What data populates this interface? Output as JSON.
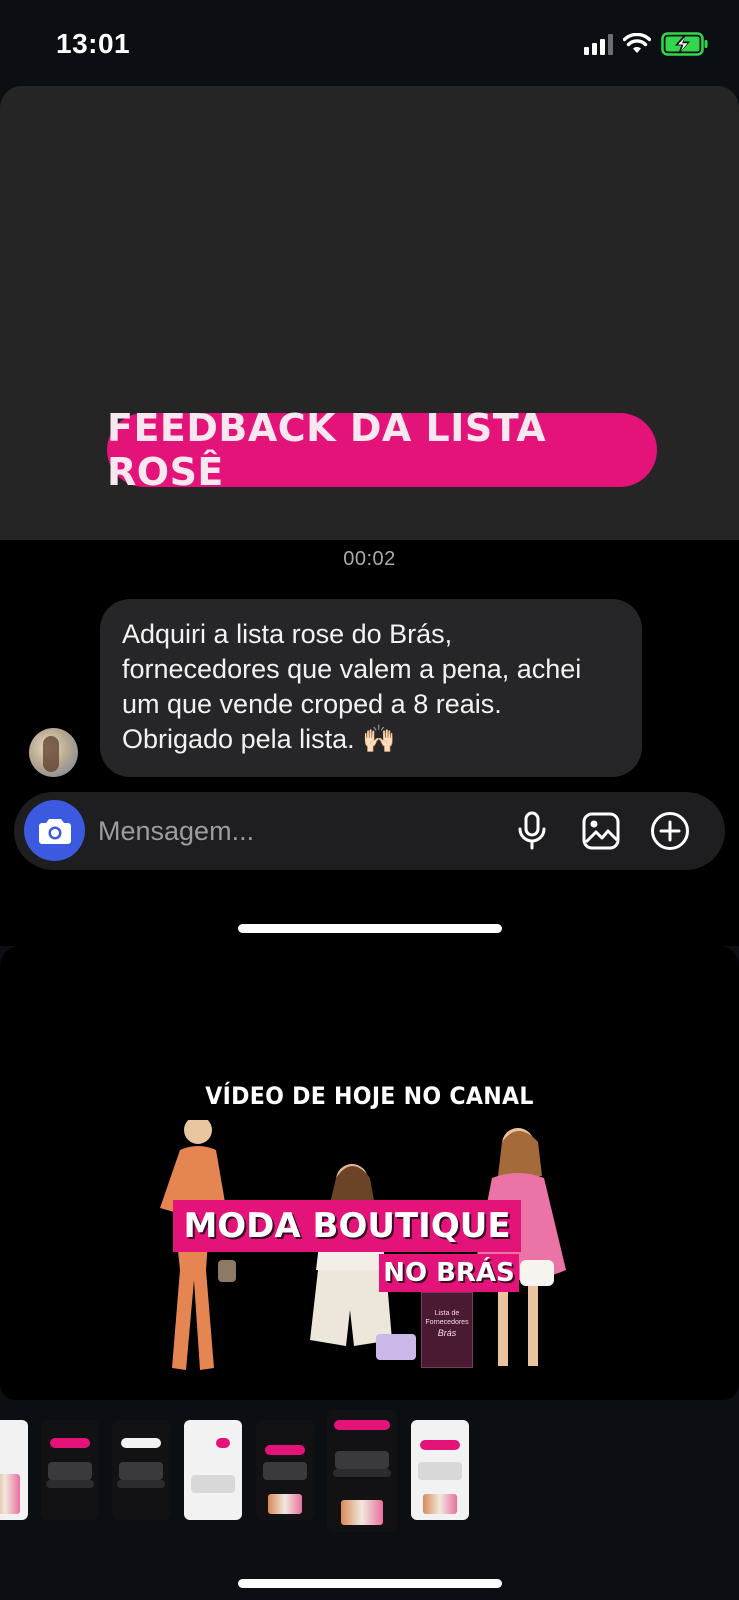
{
  "status_bar": {
    "time": "13:01",
    "icons": [
      "cellular-signal-icon",
      "wifi-icon",
      "battery-charging-icon"
    ]
  },
  "story": {
    "pill_text": "FEEDBACK DA LISTA ROSÊ"
  },
  "chat": {
    "timestamp": "00:02",
    "message_lines": [
      "Adquiri a lista rose do Brás,",
      "fornecedores que valem a pena, achei",
      "um que vende croped a 8 reais.",
      "Obrigado pela lista. 🙌🏻"
    ]
  },
  "composer": {
    "placeholder": "Mensagem...",
    "icons": [
      "camera-icon",
      "microphone-icon",
      "gallery-icon",
      "add-icon"
    ]
  },
  "video": {
    "caption": "VÍDEO DE HOJE NO CANAL",
    "banner_title": "MODA BOUTIQUE",
    "banner_subtitle": "NO BRÁS",
    "book_lines": [
      "Lista de",
      "Fornecedores",
      "Brás"
    ]
  },
  "colors": {
    "accent_pink": "#e4137a",
    "camera_blue": "#3b5ae0",
    "bubble": "#262628",
    "background": "#0b0e13"
  }
}
